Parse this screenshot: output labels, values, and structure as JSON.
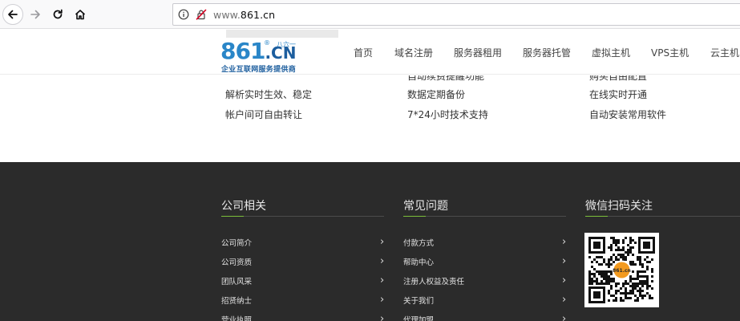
{
  "browser": {
    "url_prefix": "www.",
    "url_host": "861.cn"
  },
  "header": {
    "logo_text": "861",
    "logo_tld": ".CN",
    "logo_mark": "®",
    "logo_small": "八六一",
    "logo_tagline": "企业互联网服务提供商",
    "nav": [
      "首页",
      "域名注册",
      "服务器租用",
      "服务器托管",
      "虚拟主机",
      "VPS主机",
      "云主机"
    ]
  },
  "features": {
    "col1": [
      "解析实时生效、稳定",
      "帐户间可自由转让"
    ],
    "col2_partial": "自动续费提醒功能",
    "col2": [
      "数据定期备份",
      "7*24小时技术支持"
    ],
    "col3_partial": "购买自由配置",
    "col3": [
      "在线实时开通",
      "自动安装常用软件"
    ]
  },
  "footer": {
    "col1": {
      "title": "公司相关",
      "items": [
        "公司简介",
        "公司资质",
        "团队风采",
        "招贤纳士",
        "营业执照"
      ]
    },
    "col2": {
      "title": "常见问题",
      "items": [
        "付款方式",
        "帮助中心",
        "注册人权益及责任",
        "关于我们",
        "代理加盟"
      ]
    },
    "col3": {
      "title": "微信扫码关注"
    },
    "qr_center_label": "861.cn",
    "accent_color": "#7bbf3a"
  }
}
